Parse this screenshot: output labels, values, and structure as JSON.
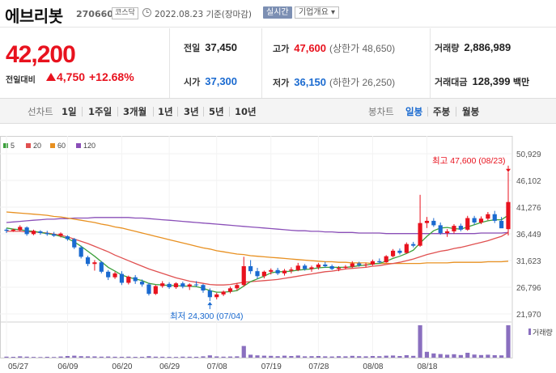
{
  "header": {
    "name": "에브리봇",
    "code": "270660",
    "market": "코스닥",
    "date": "2022.08.23",
    "date_suffix": "기준(장마감)",
    "realtime": "실시간",
    "company_info": "기업개요 ▾"
  },
  "quote": {
    "price": "42,200",
    "change_label": "전일대비",
    "change": "4,750",
    "change_pct": "+12.68%"
  },
  "stats": {
    "prev_label": "전일",
    "prev": "37,450",
    "high_label": "고가",
    "high": "47,600",
    "high_sub": "(상한가 48,650)",
    "volume_label": "거래량",
    "volume": "2,886,989",
    "open_label": "시가",
    "open": "37,300",
    "low_label": "저가",
    "low": "36,150",
    "low_sub": "(하한가 26,250)",
    "amount_label": "거래대금",
    "amount": "128,399",
    "amount_unit": "백만"
  },
  "tabs": {
    "line_label": "선차트",
    "periods": [
      "1일",
      "1주일",
      "3개월",
      "1년",
      "3년",
      "5년",
      "10년"
    ],
    "candle_label": "봉차트",
    "candles": [
      "일봉",
      "주봉",
      "월봉"
    ],
    "active_candle": "일봉"
  },
  "colors": {
    "up": "#e8121e",
    "down": "#1a6ad0",
    "ma5": "#3ca03c",
    "ma20": "#e05050",
    "ma60": "#e89020",
    "ma120": "#8a4fb8",
    "volume": "#8a6fbf"
  },
  "chart_data": {
    "type": "candlestick",
    "legend": [
      {
        "label": "5",
        "color": "#3ca03c"
      },
      {
        "label": "20",
        "color": "#e05050"
      },
      {
        "label": "60",
        "color": "#e89020"
      },
      {
        "label": "120",
        "color": "#8a4fb8"
      }
    ],
    "y_ticks": [
      "50,929",
      "46,102",
      "41,276",
      "36,449",
      "31,623",
      "26,796",
      "21,970"
    ],
    "ylim": [
      21970,
      50929
    ],
    "x_ticks": [
      "05/27",
      "06/09",
      "06/20",
      "06/29",
      "07/08",
      "07/19",
      "07/28",
      "08/08",
      "08/18"
    ],
    "annotations": {
      "high": "최고 47,600 (08/23)",
      "low": "최저 24,300 (07/04)"
    },
    "volume_label": "거래량",
    "candles": [
      [
        37200,
        37500,
        36600,
        37000
      ],
      [
        37000,
        37400,
        36800,
        37200
      ],
      [
        37100,
        38000,
        36900,
        37700
      ],
      [
        37600,
        37800,
        36100,
        36400
      ],
      [
        36400,
        37200,
        36200,
        37000
      ],
      [
        36900,
        37100,
        36300,
        36600
      ],
      [
        36600,
        37000,
        36100,
        36400
      ],
      [
        36400,
        36800,
        35900,
        36100
      ],
      [
        36100,
        36700,
        35800,
        36500
      ],
      [
        36000,
        36200,
        35200,
        35500
      ],
      [
        35500,
        35700,
        33700,
        34000
      ],
      [
        34000,
        34300,
        32000,
        32300
      ],
      [
        32200,
        32500,
        30600,
        31000
      ],
      [
        31000,
        31700,
        29800,
        31300
      ],
      [
        31300,
        31500,
        29300,
        29600
      ],
      [
        29600,
        29900,
        28100,
        28600
      ],
      [
        28600,
        29600,
        28300,
        29300
      ],
      [
        29200,
        29700,
        27200,
        27600
      ],
      [
        27600,
        28900,
        27300,
        28700
      ],
      [
        28600,
        29000,
        27400,
        27900
      ],
      [
        27800,
        28200,
        26900,
        27300
      ],
      [
        27300,
        27600,
        25300,
        25600
      ],
      [
        25600,
        27200,
        25400,
        27000
      ],
      [
        27000,
        27900,
        26700,
        27500
      ],
      [
        27400,
        27700,
        26500,
        26800
      ],
      [
        26800,
        27700,
        26500,
        27500
      ],
      [
        27500,
        27800,
        26600,
        26900
      ],
      [
        26900,
        27500,
        26300,
        27300
      ],
      [
        27300,
        27900,
        26900,
        27200
      ],
      [
        27200,
        27400,
        25800,
        26200
      ],
      [
        26200,
        26600,
        24300,
        25000
      ],
      [
        25000,
        25800,
        24600,
        25500
      ],
      [
        25500,
        26200,
        25200,
        26000
      ],
      [
        26000,
        26900,
        25700,
        26600
      ],
      [
        26600,
        27500,
        26200,
        27200
      ],
      [
        27200,
        32300,
        26900,
        30600
      ],
      [
        30600,
        31700,
        29200,
        29700
      ],
      [
        29700,
        30300,
        28300,
        28800
      ],
      [
        28800,
        29800,
        28400,
        29600
      ],
      [
        29600,
        30200,
        29100,
        29900
      ],
      [
        29900,
        30300,
        29000,
        29300
      ],
      [
        29300,
        30100,
        28900,
        29800
      ],
      [
        29800,
        30400,
        29300,
        30000
      ],
      [
        29900,
        31200,
        29700,
        30700
      ],
      [
        30700,
        31000,
        29800,
        30100
      ],
      [
        30100,
        30700,
        29600,
        30400
      ],
      [
        30400,
        31200,
        30000,
        30900
      ],
      [
        30900,
        31400,
        30300,
        30600
      ],
      [
        30600,
        30900,
        29900,
        30100
      ],
      [
        30100,
        30600,
        29700,
        30300
      ],
      [
        30300,
        30800,
        30000,
        30500
      ],
      [
        30500,
        31500,
        30300,
        31100
      ],
      [
        31100,
        31400,
        30500,
        30800
      ],
      [
        30800,
        31200,
        30400,
        30900
      ],
      [
        30900,
        31800,
        30700,
        31500
      ],
      [
        31500,
        32000,
        31100,
        31300
      ],
      [
        31300,
        32600,
        31200,
        32400
      ],
      [
        32400,
        33700,
        32200,
        33400
      ],
      [
        33400,
        33800,
        32700,
        33000
      ],
      [
        33000,
        34900,
        32900,
        34600
      ],
      [
        34600,
        35000,
        34000,
        34300
      ],
      [
        34300,
        43500,
        34100,
        38400
      ],
      [
        38400,
        39500,
        37500,
        38800
      ],
      [
        38800,
        39300,
        37700,
        38000
      ],
      [
        38000,
        38500,
        36300,
        36600
      ],
      [
        36600,
        37300,
        35900,
        36900
      ],
      [
        36900,
        38200,
        36500,
        37900
      ],
      [
        37900,
        38300,
        36900,
        37200
      ],
      [
        37200,
        39700,
        37000,
        39300
      ],
      [
        39300,
        39700,
        38100,
        38500
      ],
      [
        38500,
        39600,
        38200,
        39200
      ],
      [
        39200,
        40400,
        38900,
        40000
      ],
      [
        40000,
        40600,
        38400,
        38800
      ],
      [
        38800,
        39500,
        37800,
        37450
      ],
      [
        37300,
        47600,
        36150,
        42200
      ]
    ],
    "volume": [
      30,
      25,
      40,
      30,
      22,
      18,
      26,
      20,
      35,
      50,
      60,
      45,
      40,
      38,
      30,
      35,
      28,
      26,
      30,
      24,
      26,
      45,
      30,
      28,
      24,
      22,
      30,
      28,
      26,
      40,
      70,
      38,
      30,
      35,
      40,
      360,
      90,
      70,
      60,
      55,
      45,
      60,
      50,
      65,
      40,
      45,
      50,
      40,
      35,
      45,
      40,
      55,
      45,
      40,
      50,
      45,
      60,
      65,
      50,
      75,
      55,
      1000,
      180,
      130,
      110,
      90,
      105,
      80,
      150,
      95,
      80,
      90,
      75,
      70,
      1000
    ],
    "ma": {
      "ma5": [
        37500,
        37300,
        37200,
        37000,
        36900,
        36700,
        36500,
        36300,
        36000,
        35600,
        35000,
        34200,
        33300,
        32400,
        31400,
        30400,
        29700,
        29000,
        28600,
        28300,
        28000,
        27500,
        27300,
        27200,
        27100,
        27100,
        27000,
        27000,
        26900,
        26600,
        26200,
        25900,
        25900,
        26000,
        26200,
        27000,
        27800,
        28300,
        28800,
        29400,
        29600,
        29600,
        29700,
        29900,
        30000,
        30100,
        30300,
        30400,
        30400,
        30400,
        30400,
        30500,
        30700,
        30800,
        31000,
        31100,
        31500,
        32000,
        32400,
        32900,
        33500,
        34800,
        36000,
        37000,
        37500,
        37600,
        37400,
        37300,
        37700,
        38100,
        38500,
        38800,
        39000,
        39000,
        39800
      ],
      "ma20": [
        36900,
        36900,
        36900,
        36800,
        36800,
        36700,
        36600,
        36400,
        36200,
        35900,
        35500,
        35100,
        34700,
        34200,
        33700,
        33200,
        32600,
        32100,
        31600,
        31100,
        30600,
        30100,
        29700,
        29300,
        28900,
        28500,
        28200,
        27900,
        27700,
        27500,
        27300,
        27200,
        27200,
        27300,
        27500,
        27700,
        27800,
        27900,
        28000,
        28100,
        28200,
        28400,
        28600,
        28800,
        29000,
        29200,
        29400,
        29600,
        29700,
        29900,
        30100,
        30200,
        30300,
        30400,
        30600,
        30700,
        30900,
        31100,
        31300,
        31600,
        31900,
        32300,
        32700,
        33000,
        33300,
        33500,
        33800,
        34000,
        34300,
        34600,
        34900,
        35200,
        35600,
        36000,
        36700
      ],
      "ma60": [
        40400,
        40300,
        40200,
        40100,
        40000,
        39900,
        39800,
        39600,
        39500,
        39300,
        39100,
        38900,
        38700,
        38500,
        38200,
        38000,
        37700,
        37500,
        37200,
        36900,
        36600,
        36300,
        36000,
        35700,
        35400,
        35100,
        34800,
        34500,
        34200,
        33900,
        33700,
        33400,
        33200,
        33000,
        32800,
        32700,
        32500,
        32400,
        32300,
        32200,
        32100,
        32000,
        31900,
        31800,
        31700,
        31600,
        31500,
        31400,
        31400,
        31300,
        31300,
        31200,
        31200,
        31200,
        31100,
        31100,
        31100,
        31100,
        31100,
        31100,
        31100,
        31100,
        31200,
        31200,
        31200,
        31200,
        31300,
        31300,
        31300,
        31300,
        31300,
        31400,
        31400,
        31400,
        31500
      ],
      "ma120": [
        38500,
        38600,
        38700,
        38800,
        38900,
        39000,
        39100,
        39100,
        39200,
        39200,
        39300,
        39300,
        39300,
        39400,
        39400,
        39400,
        39400,
        39400,
        39400,
        39300,
        39300,
        39200,
        39100,
        39000,
        38900,
        38800,
        38700,
        38600,
        38500,
        38400,
        38300,
        38200,
        38100,
        38000,
        37900,
        37800,
        37700,
        37600,
        37500,
        37400,
        37300,
        37200,
        37100,
        37000,
        37000,
        36900,
        36900,
        36800,
        36800,
        36700,
        36700,
        36700,
        36600,
        36600,
        36600,
        36600,
        36500,
        36500,
        36500,
        36500,
        36500,
        36500,
        36500,
        36500,
        36500,
        36500,
        36500,
        36500,
        36500,
        36500,
        36600,
        36600,
        36600,
        36600,
        36700
      ]
    }
  }
}
